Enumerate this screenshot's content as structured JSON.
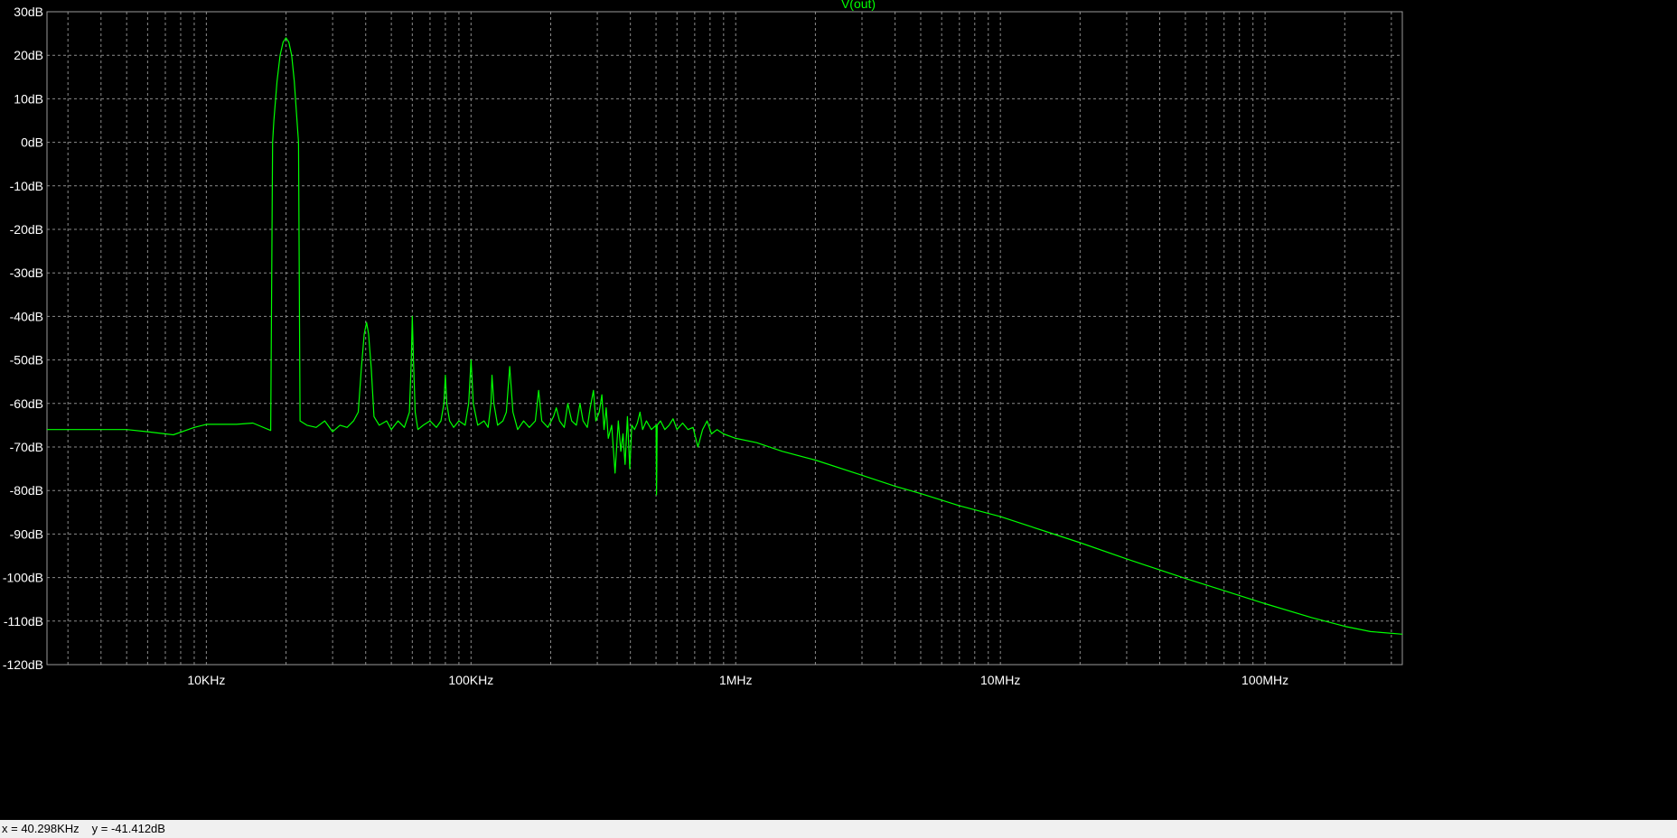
{
  "window": {
    "trace_label": "V(out)"
  },
  "colors": {
    "background": "#000000",
    "trace": "#00ff00",
    "grid": "#8c8c8c",
    "axis_text": "#ffffff",
    "status_bg": "#f0f0f0"
  },
  "status": {
    "x_readout": "x = 40.298KHz",
    "y_readout": "y = -41.412dB"
  },
  "chart_data": {
    "type": "line",
    "title": "V(out)",
    "xscale": "log",
    "xlim": [
      2500,
      330000000
    ],
    "ylim": [
      -120,
      30
    ],
    "grid": true,
    "grid_style": "dashed",
    "x_ticks": [
      {
        "value": 10000,
        "label": "10KHz"
      },
      {
        "value": 100000,
        "label": "100KHz"
      },
      {
        "value": 1000000,
        "label": "1MHz"
      },
      {
        "value": 10000000,
        "label": "10MHz"
      },
      {
        "value": 100000000,
        "label": "100MHz"
      }
    ],
    "y_ticks": [
      {
        "value": 30,
        "label": "30dB"
      },
      {
        "value": 20,
        "label": "20dB"
      },
      {
        "value": 10,
        "label": "10dB"
      },
      {
        "value": 0,
        "label": "0dB"
      },
      {
        "value": -10,
        "label": "-10dB"
      },
      {
        "value": -20,
        "label": "-20dB"
      },
      {
        "value": -30,
        "label": "-30dB"
      },
      {
        "value": -40,
        "label": "-40dB"
      },
      {
        "value": -50,
        "label": "-50dB"
      },
      {
        "value": -60,
        "label": "-60dB"
      },
      {
        "value": -70,
        "label": "-70dB"
      },
      {
        "value": -80,
        "label": "-80dB"
      },
      {
        "value": -90,
        "label": "-90dB"
      },
      {
        "value": -100,
        "label": "-100dB"
      },
      {
        "value": -110,
        "label": "-110dB"
      },
      {
        "value": -120,
        "label": "-120dB"
      }
    ],
    "series": [
      {
        "name": "V(out)",
        "color": "#00ff00",
        "points": [
          [
            2500,
            -66
          ],
          [
            5000,
            -66
          ],
          [
            6000,
            -66.5
          ],
          [
            7500,
            -67.2
          ],
          [
            9000,
            -65.5
          ],
          [
            10000,
            -64.8
          ],
          [
            13000,
            -64.8
          ],
          [
            15000,
            -64.5
          ],
          [
            17500,
            -66.2
          ],
          [
            17800,
            0
          ],
          [
            18000,
            5
          ],
          [
            18500,
            14
          ],
          [
            19000,
            20
          ],
          [
            19500,
            23
          ],
          [
            20000,
            24
          ],
          [
            20500,
            23
          ],
          [
            21000,
            20
          ],
          [
            21500,
            14
          ],
          [
            22000,
            5
          ],
          [
            22300,
            0
          ],
          [
            22600,
            -64
          ],
          [
            24000,
            -65
          ],
          [
            26000,
            -65.5
          ],
          [
            28000,
            -64
          ],
          [
            30000,
            -66.5
          ],
          [
            32000,
            -65
          ],
          [
            34000,
            -65.5
          ],
          [
            36000,
            -64
          ],
          [
            37500,
            -62
          ],
          [
            38500,
            -52
          ],
          [
            39500,
            -44
          ],
          [
            40300,
            -41.4
          ],
          [
            41000,
            -44
          ],
          [
            42000,
            -52
          ],
          [
            43000,
            -63
          ],
          [
            45000,
            -65
          ],
          [
            48000,
            -64
          ],
          [
            50000,
            -66
          ],
          [
            53000,
            -64
          ],
          [
            56000,
            -65.5
          ],
          [
            58500,
            -62
          ],
          [
            59500,
            -50
          ],
          [
            60000,
            -40
          ],
          [
            60600,
            -50
          ],
          [
            61500,
            -62
          ],
          [
            63000,
            -66
          ],
          [
            66000,
            -65
          ],
          [
            70000,
            -64
          ],
          [
            74000,
            -65.5
          ],
          [
            77000,
            -64
          ],
          [
            79000,
            -60
          ],
          [
            80000,
            -53.5
          ],
          [
            81000,
            -60
          ],
          [
            83000,
            -64
          ],
          [
            86000,
            -65.5
          ],
          [
            90000,
            -64
          ],
          [
            95000,
            -65
          ],
          [
            98000,
            -60
          ],
          [
            100000,
            -50
          ],
          [
            102000,
            -60
          ],
          [
            106000,
            -65
          ],
          [
            112000,
            -64
          ],
          [
            116000,
            -65.5
          ],
          [
            119000,
            -60
          ],
          [
            120000,
            -53.5
          ],
          [
            122000,
            -60
          ],
          [
            126000,
            -65
          ],
          [
            132000,
            -64
          ],
          [
            136000,
            -62
          ],
          [
            140000,
            -51.5
          ],
          [
            144000,
            -62
          ],
          [
            150000,
            -66
          ],
          [
            158000,
            -64
          ],
          [
            166000,
            -65.5
          ],
          [
            175000,
            -64
          ],
          [
            180000,
            -57
          ],
          [
            185000,
            -64
          ],
          [
            195000,
            -65.5
          ],
          [
            205000,
            -63
          ],
          [
            210000,
            -61
          ],
          [
            216000,
            -64
          ],
          [
            225000,
            -65.5
          ],
          [
            232000,
            -60
          ],
          [
            240000,
            -64
          ],
          [
            250000,
            -65
          ],
          [
            258000,
            -60
          ],
          [
            265000,
            -64
          ],
          [
            275000,
            -65.5
          ],
          [
            282000,
            -61
          ],
          [
            290000,
            -57
          ],
          [
            296000,
            -64
          ],
          [
            305000,
            -62
          ],
          [
            312000,
            -58
          ],
          [
            318000,
            -66
          ],
          [
            324000,
            -61
          ],
          [
            330000,
            -68
          ],
          [
            340000,
            -65
          ],
          [
            350000,
            -76
          ],
          [
            360000,
            -64
          ],
          [
            368000,
            -71
          ],
          [
            375000,
            -67
          ],
          [
            382000,
            -74
          ],
          [
            390000,
            -63
          ],
          [
            398000,
            -75
          ],
          [
            405000,
            -65
          ],
          [
            415000,
            -66
          ],
          [
            425000,
            -64.5
          ],
          [
            435000,
            -62
          ],
          [
            445000,
            -66
          ],
          [
            460000,
            -64
          ],
          [
            480000,
            -66
          ],
          [
            500000,
            -65
          ],
          [
            502000,
            -81
          ],
          [
            505000,
            -65
          ],
          [
            520000,
            -64
          ],
          [
            540000,
            -66
          ],
          [
            560000,
            -65
          ],
          [
            580000,
            -63.5
          ],
          [
            600000,
            -66
          ],
          [
            630000,
            -64.5
          ],
          [
            660000,
            -66
          ],
          [
            690000,
            -65.5
          ],
          [
            720000,
            -70
          ],
          [
            750000,
            -66
          ],
          [
            780000,
            -64
          ],
          [
            810000,
            -67
          ],
          [
            850000,
            -66
          ],
          [
            900000,
            -67
          ],
          [
            1000000,
            -68
          ],
          [
            1200000,
            -69
          ],
          [
            1500000,
            -71
          ],
          [
            2000000,
            -73
          ],
          [
            3000000,
            -76.5
          ],
          [
            4000000,
            -79
          ],
          [
            5000000,
            -80.7
          ],
          [
            7000000,
            -83.5
          ],
          [
            10000000,
            -86
          ],
          [
            15000000,
            -89.5
          ],
          [
            20000000,
            -92
          ],
          [
            30000000,
            -95.7
          ],
          [
            50000000,
            -100.2
          ],
          [
            70000000,
            -103
          ],
          [
            100000000,
            -106
          ],
          [
            150000000,
            -109.2
          ],
          [
            200000000,
            -111.2
          ],
          [
            250000000,
            -112.4
          ],
          [
            330000000,
            -113
          ]
        ]
      }
    ]
  }
}
